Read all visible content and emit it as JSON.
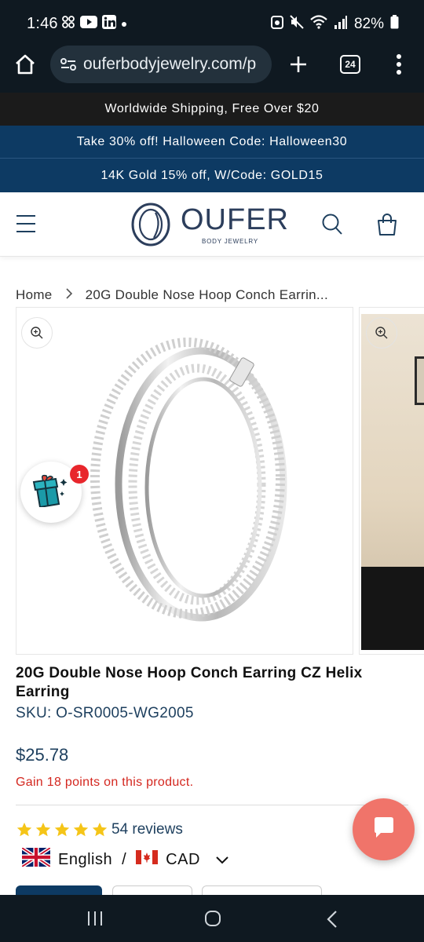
{
  "status_bar": {
    "time": "1:46",
    "battery": "82%",
    "notification_icons": [
      "pinwheel-icon",
      "youtube-icon",
      "linkedin-icon",
      "dot-icon"
    ],
    "system_icons": [
      "alarm-icon",
      "mute-icon",
      "wifi-icon",
      "signal-icon",
      "battery-icon"
    ]
  },
  "browser": {
    "url": "ouferbodyjewelry.com/p",
    "tab_count": "24"
  },
  "banners": [
    {
      "text": "Worldwide Shipping, Free Over $20",
      "bg": "#1b1b1b"
    },
    {
      "text": "Take 30% off! Halloween Code: Halloween30",
      "bg": "#0d3a63"
    },
    {
      "text": "14K Gold 15% off, W/Code: GOLD15",
      "bg": "#0d3a63"
    }
  ],
  "header": {
    "logo_text": "OUFER",
    "logo_subtext": "BODY JEWELRY"
  },
  "breadcrumb": {
    "home": "Home",
    "current": "20G Double Nose Hoop Conch Earrin..."
  },
  "promo": {
    "badge_count": "1"
  },
  "product": {
    "title": "20G Double Nose Hoop Conch Earring CZ Helix Earring",
    "sku": "SKU: O-SR0005-WG2005",
    "price": "$25.78",
    "points": "Gain 18 points on this product.",
    "rating": 5,
    "reviews": "54 reviews"
  },
  "locale": {
    "language": "English",
    "separator": "/",
    "currency": "CAD"
  },
  "colors": {
    "accent": "#0d3a63",
    "price": "#1d3f5e",
    "points": "#d4271f",
    "star": "#f5c518",
    "chat": "#f0746a"
  }
}
